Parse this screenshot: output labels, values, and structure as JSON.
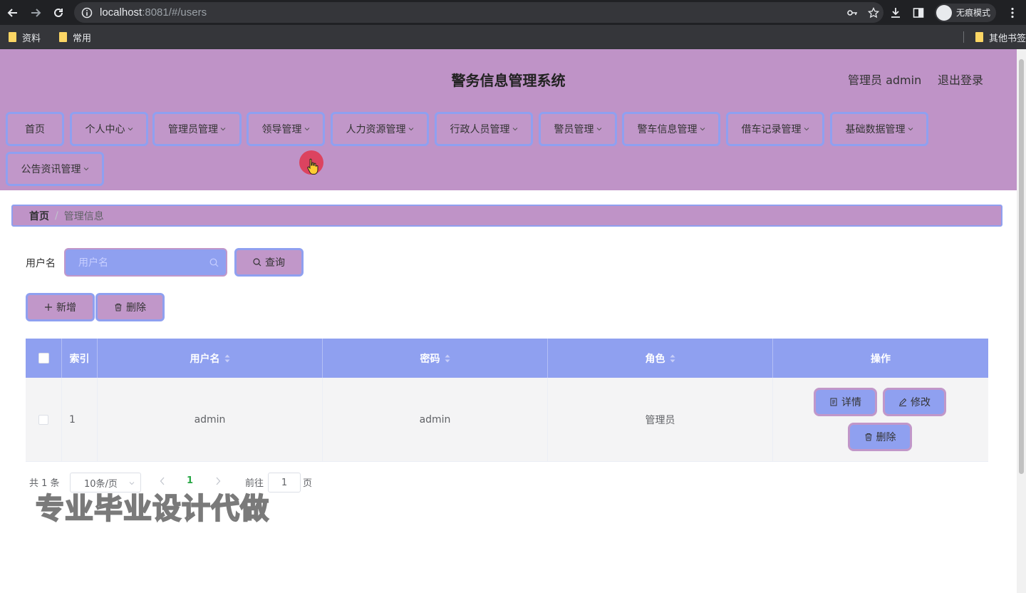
{
  "browser": {
    "url_host": "localhost",
    "url_rest": ":8081/#/users",
    "incognito_label": "无痕模式",
    "bookmarks": [
      "资料",
      "常用"
    ],
    "other_bookmarks": "其他书签"
  },
  "header": {
    "title": "警务信息管理系统",
    "user": "管理员 admin",
    "logout": "退出登录"
  },
  "menu": {
    "items": [
      {
        "label": "首页",
        "has_dropdown": false
      },
      {
        "label": "个人中心",
        "has_dropdown": true
      },
      {
        "label": "管理员管理",
        "has_dropdown": true
      },
      {
        "label": "领导管理",
        "has_dropdown": true
      },
      {
        "label": "人力资源管理",
        "has_dropdown": true
      },
      {
        "label": "行政人员管理",
        "has_dropdown": true
      },
      {
        "label": "警员管理",
        "has_dropdown": true
      },
      {
        "label": "警车信息管理",
        "has_dropdown": true
      },
      {
        "label": "借车记录管理",
        "has_dropdown": true
      },
      {
        "label": "基础数据管理",
        "has_dropdown": true
      },
      {
        "label": "公告资讯管理",
        "has_dropdown": true
      }
    ]
  },
  "breadcrumb": {
    "home": "首页",
    "separator": "/",
    "current": "管理信息"
  },
  "search": {
    "label": "用户名",
    "placeholder": "用户名",
    "button": "查询"
  },
  "actions": {
    "add": "新增",
    "delete": "删除"
  },
  "table": {
    "columns": [
      "索引",
      "用户名",
      "密码",
      "角色",
      "操作"
    ],
    "rows": [
      {
        "index": "1",
        "username": "admin",
        "password": "admin",
        "role": "管理员"
      }
    ],
    "row_actions": {
      "detail": "详情",
      "edit": "修改",
      "delete": "删除"
    }
  },
  "pagination": {
    "total": "共 1 条",
    "page_size": "10条/页",
    "current_page": "1",
    "goto_label": "前往",
    "goto_value": "1",
    "page_unit": "页"
  },
  "watermark": "专业毕业设计代做",
  "colors": {
    "header_bg": "#bf93c7",
    "accent_blue": "#8fa0f0",
    "pager_active": "#28a745"
  }
}
